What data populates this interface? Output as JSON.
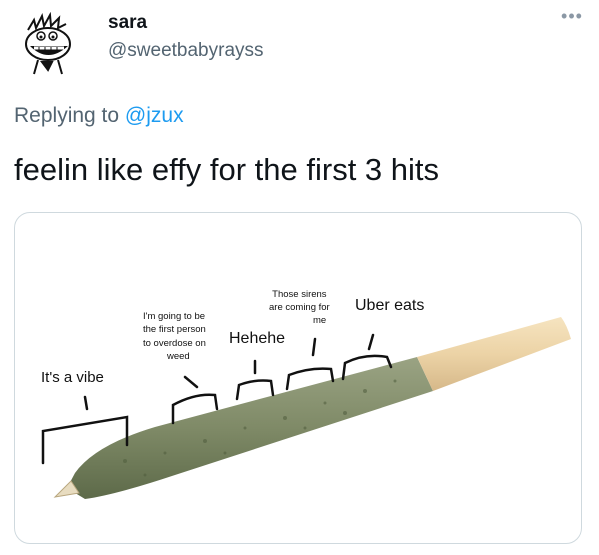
{
  "user": {
    "display_name": "sara",
    "handle": "@sweetbabyrayss"
  },
  "more_icon": "more-horizontal-icon",
  "reply": {
    "prefix": "Replying to",
    "mention": "@jzux"
  },
  "tweet": {
    "text": "feelin like effy for the first 3 hits"
  },
  "meme": {
    "label_vibe": "It's a vibe",
    "label_overdose_lines": [
      "I'm going to be",
      "the first person",
      "to overdose on",
      "weed"
    ],
    "label_hehe": "Hehehe",
    "label_sirens_lines": [
      "Those sirens",
      "are coming for",
      "me"
    ],
    "label_uber": "Uber eats"
  },
  "colors": {
    "handle_gray": "#536471",
    "link_blue": "#1d9bf0",
    "border": "#cfd9de"
  }
}
